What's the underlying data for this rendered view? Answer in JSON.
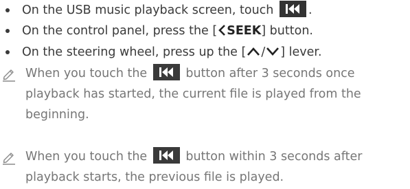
{
  "bullets": [
    {
      "before": "On the USB music playback screen, touch",
      "after": ".",
      "icon": "skip-previous-button-icon"
    },
    {
      "before": "On the control panel, press the [",
      "key_glyph": "chevron-left-icon",
      "key": "SEEK",
      "after": "] button."
    },
    {
      "before": "On the steering wheel, press up the [",
      "glyphs": [
        "chevron-up-icon",
        "/",
        "chevron-down-icon"
      ],
      "slash": "/",
      "after": "] lever."
    }
  ],
  "notes": [
    {
      "icon": "pencil-note-icon",
      "line1_before": "When you touch the",
      "line1_after": "button after 3 seconds once",
      "line2": "playback has started, the current file is played from the",
      "line3": "beginning."
    },
    {
      "icon": "pencil-note-icon",
      "line1_before": "When you touch the",
      "line1_after": "button within 3 seconds after",
      "line2": "playback starts, the previous file is played."
    }
  ],
  "colors": {
    "body_text": "#3a3a3a",
    "note_text": "#767676",
    "icon_bg": "#333333",
    "icon_fg": "#ffffff"
  }
}
